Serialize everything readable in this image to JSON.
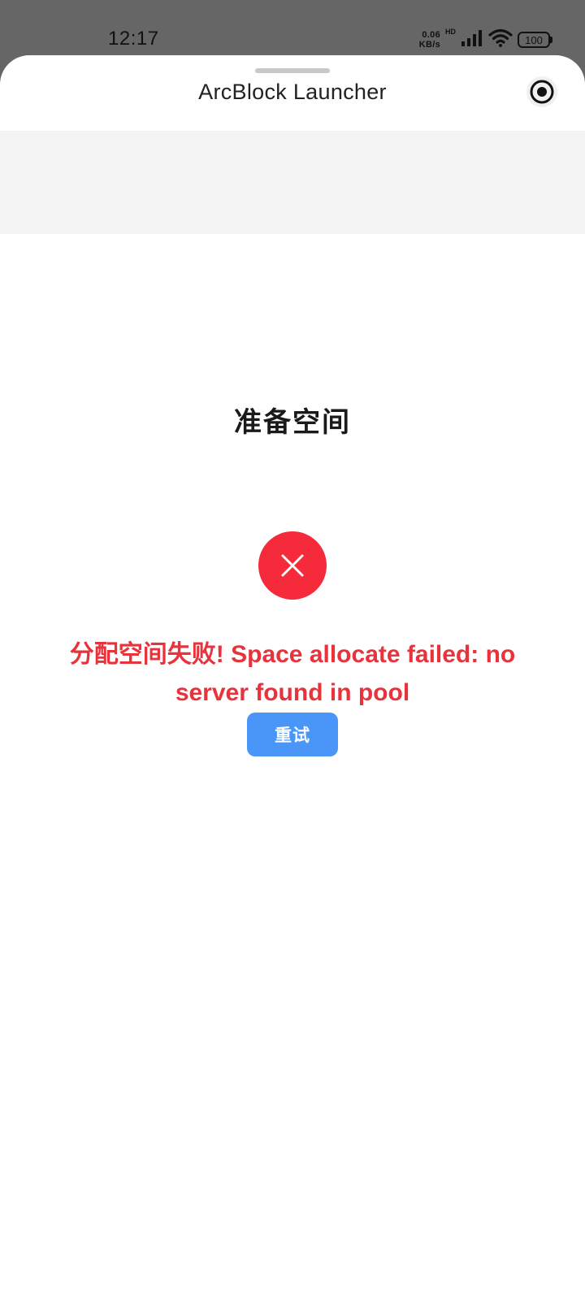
{
  "status_bar": {
    "time": "12:17",
    "net_speed_value": "0.06",
    "net_speed_unit": "KB/s",
    "network_tag": "HD",
    "battery": "100",
    "icons": [
      "signal-icon",
      "wifi-icon",
      "battery-icon"
    ]
  },
  "sheet": {
    "title": "ArcBlock Launcher",
    "capsule_icon": "target-icon"
  },
  "main": {
    "heading": "准备空间",
    "error_icon": "close-icon",
    "error_message": "分配空间失败! Space allocate failed: no server found in pool",
    "retry_label": "重试"
  },
  "colors": {
    "status_bar_bg": "#666666",
    "error_red": "#f52a3a",
    "error_text": "#e8323c",
    "button_blue": "#4a96f8"
  }
}
